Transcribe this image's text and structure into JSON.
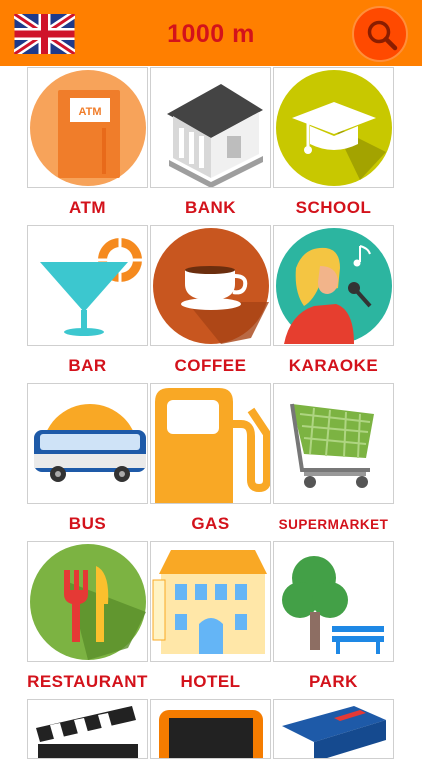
{
  "header": {
    "title": "1000 m",
    "language_flag": "uk-flag-icon",
    "search_icon": "search-icon",
    "bar_color": "#ff7f00",
    "title_color": "#d3121b"
  },
  "categories": [
    {
      "label": "ATM",
      "icon": "atm-icon"
    },
    {
      "label": "BANK",
      "icon": "bank-icon"
    },
    {
      "label": "SCHOOL",
      "icon": "graduation-cap-icon"
    },
    {
      "label": "BAR",
      "icon": "cocktail-icon"
    },
    {
      "label": "COFFEE",
      "icon": "coffee-cup-icon"
    },
    {
      "label": "KARAOKE",
      "icon": "singer-microphone-icon"
    },
    {
      "label": "BUS",
      "icon": "bus-icon"
    },
    {
      "label": "GAS",
      "icon": "gas-pump-icon"
    },
    {
      "label": "SUPERMARKET",
      "icon": "shopping-cart-icon"
    },
    {
      "label": "RESTAURANT",
      "icon": "fork-knife-icon"
    },
    {
      "label": "HOTEL",
      "icon": "hotel-building-icon"
    },
    {
      "label": "PARK",
      "icon": "tree-bench-icon"
    },
    {
      "label": "",
      "icon": "clapperboard-icon"
    },
    {
      "label": "",
      "icon": "tv-screen-icon"
    },
    {
      "label": "",
      "icon": "book-icon"
    }
  ]
}
